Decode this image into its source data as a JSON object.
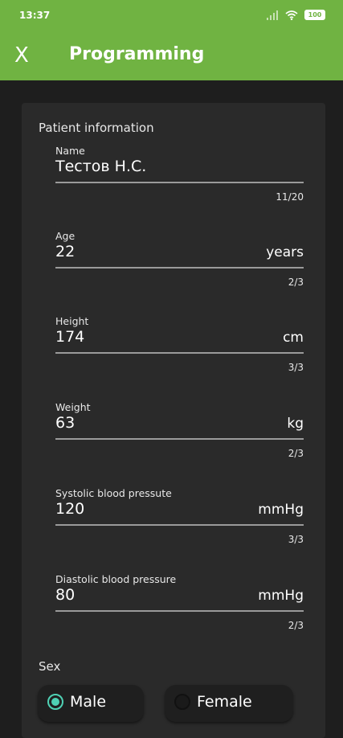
{
  "status_bar": {
    "time": "13:37",
    "battery": "100",
    "icons": [
      "signal-icon",
      "wifi-icon",
      "battery-icon"
    ]
  },
  "app_bar": {
    "close_label": "X",
    "title": "Programming"
  },
  "colors": {
    "accent": "#70b342",
    "radio_checked": "#4fd1b4",
    "background": "#1e1e1e",
    "card": "#2a2a2a"
  },
  "form": {
    "section_title": "Patient information",
    "fields": [
      {
        "label": "Name",
        "value": "Тестов Н.С.",
        "suffix": "",
        "counter": "11/20"
      },
      {
        "label": "Age",
        "value": "22",
        "suffix": "years",
        "counter": "2/3"
      },
      {
        "label": "Height",
        "value": "174",
        "suffix": "cm",
        "counter": "3/3"
      },
      {
        "label": "Weight",
        "value": "63",
        "suffix": "kg",
        "counter": "2/3"
      },
      {
        "label": "Systolic blood pressute",
        "value": "120",
        "suffix": "mmHg",
        "counter": "3/3"
      },
      {
        "label": "Diastolic blood pressure",
        "value": "80",
        "suffix": "mmHg",
        "counter": "2/3"
      }
    ],
    "sex": {
      "label": "Sex",
      "options": [
        {
          "label": "Male",
          "selected": true
        },
        {
          "label": "Female",
          "selected": false
        }
      ]
    }
  }
}
